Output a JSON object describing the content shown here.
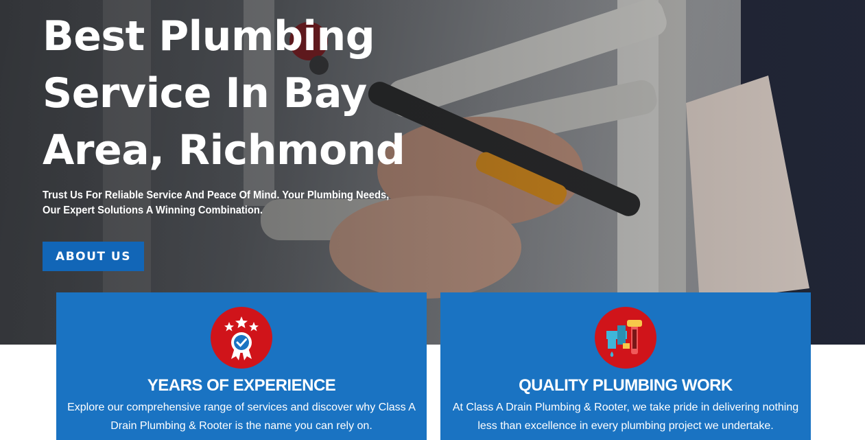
{
  "hero": {
    "title": "Best Plumbing Service In Bay Area, Richmond",
    "subtitle": "Trust Us For Reliable Service And Peace Of Mind. Your Plumbing Needs, Our Expert Solutions A Winning Combination.",
    "button_label": "ABOUT US",
    "background": "plumber-fixing-pipe-photo"
  },
  "features": [
    {
      "icon": "award-badge-icon",
      "title": "YEARS OF EXPERIENCE",
      "text": "Explore our comprehensive range of services and discover why Class A Drain Plumbing & Rooter is the name you can rely on."
    },
    {
      "icon": "pipe-wrench-icon",
      "title": "QUALITY PLUMBING WORK",
      "text": "At Class A Drain Plumbing & Rooter, we take pride in delivering nothing less than excellence in every plumbing project we undertake."
    }
  ],
  "colors": {
    "accent_blue": "#1266b7",
    "card_blue": "#1a73c2",
    "icon_red": "#d0141a"
  }
}
